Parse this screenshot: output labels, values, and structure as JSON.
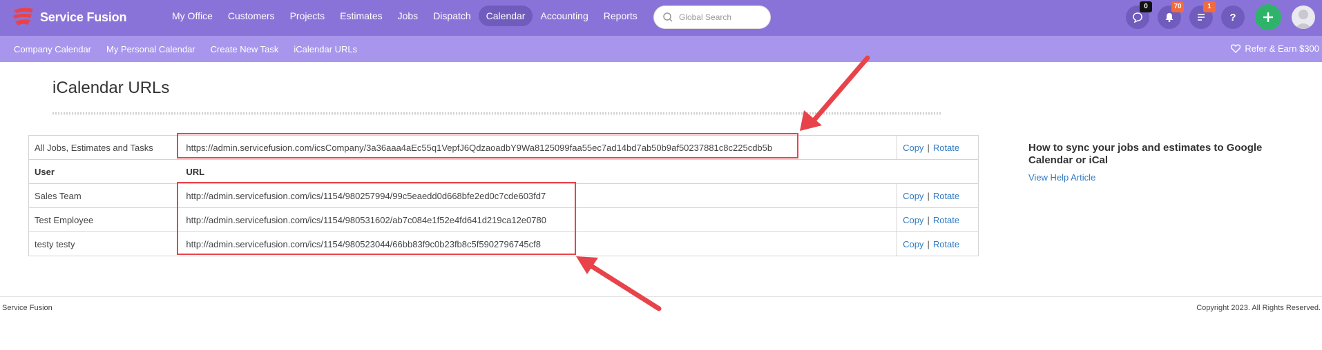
{
  "brand": {
    "name": "Service Fusion",
    "logo_color": "#e8434a"
  },
  "topnav": {
    "items": [
      {
        "label": "My Office",
        "active": false
      },
      {
        "label": "Customers",
        "active": false
      },
      {
        "label": "Projects",
        "active": false
      },
      {
        "label": "Estimates",
        "active": false
      },
      {
        "label": "Jobs",
        "active": false
      },
      {
        "label": "Dispatch",
        "active": false
      },
      {
        "label": "Calendar",
        "active": true
      },
      {
        "label": "Accounting",
        "active": false
      },
      {
        "label": "Reports",
        "active": false
      }
    ],
    "search_placeholder": "Global Search",
    "icons": [
      {
        "name": "chat-icon",
        "badge": "0",
        "badge_color": "#111111"
      },
      {
        "name": "bell-icon",
        "badge": "70",
        "badge_color": "#f26a3d"
      },
      {
        "name": "tasks-list-icon",
        "badge": "1",
        "badge_color": "#f26a3d"
      },
      {
        "name": "help-icon",
        "badge": ""
      }
    ],
    "plus_color": "#2fb36b"
  },
  "subnav": {
    "items": [
      "Company Calendar",
      "My Personal Calendar",
      "Create New Task",
      "iCalendar URLs"
    ],
    "refer_label": "Refer & Earn $300"
  },
  "page": {
    "title": "iCalendar URLs",
    "company_row": {
      "label": "All Jobs, Estimates and Tasks",
      "url": "https://admin.servicefusion.com/icsCompany/3a36aaa4aEc55q1VepfJ6QdzaoadbY9Wa8125099faa55ec7ad14bd7ab50b9af50237881c8c225cdb5b"
    },
    "columns": {
      "user": "User",
      "url": "URL"
    },
    "rows": [
      {
        "user": "Sales Team",
        "url": "http://admin.servicefusion.com/ics/1154/980257994/99c5eaedd0d668bfe2ed0c7cde603fd7"
      },
      {
        "user": "Test Employee",
        "url": "http://admin.servicefusion.com/ics/1154/980531602/ab7c084e1f52e4fd641d219ca12e0780"
      },
      {
        "user": "testy testy",
        "url": "http://admin.servicefusion.com/ics/1154/980523044/66bb83f9c0b23fb8c5f5902796745cf8"
      }
    ],
    "copy_label": "Copy",
    "rotate_label": "Rotate",
    "separator": "|"
  },
  "sidebar": {
    "title": "How to sync your jobs and estimates to Google Calendar or iCal",
    "link": "View Help Article"
  },
  "footer": {
    "left": "Service Fusion",
    "right": "Copyright 2023. All Rights Reserved."
  },
  "annotation_color": "#e8434a"
}
